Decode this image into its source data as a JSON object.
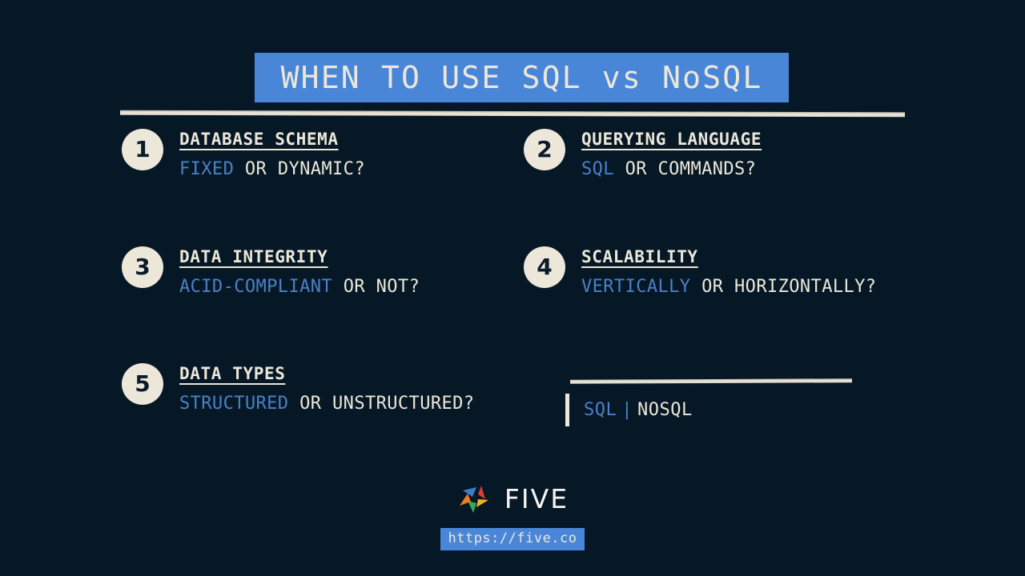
{
  "slide": {
    "title": "WHEN TO USE SQL vs NoSQL",
    "background_color": "#061826",
    "accent_blue": "#4a81c8",
    "highlight_blue": "#4a86d8",
    "cream": "#ece7d9"
  },
  "items": [
    {
      "number": "1",
      "title": "DATABASE SCHEMA",
      "sub_accent": "FIXED",
      "sub_rest": " OR DYNAMIC?"
    },
    {
      "number": "2",
      "title": "QUERYING LANGUAGE",
      "sub_accent": "SQL",
      "sub_rest": " OR COMMANDS?"
    },
    {
      "number": "3",
      "title": "DATA INTEGRITY",
      "sub_accent": "ACID-COMPLIANT",
      "sub_rest": " OR NOT?"
    },
    {
      "number": "4",
      "title": "SCALABILITY",
      "sub_accent": "VERTICALLY",
      "sub_rest": " OR HORIZONTALLY?"
    },
    {
      "number": "5",
      "title": "DATA TYPES",
      "sub_accent": "STRUCTURED",
      "sub_rest": " OR UNSTRUCTURED?"
    }
  ],
  "legend": {
    "left_label": "SQL",
    "separator": "|",
    "right_label": "NOSQL"
  },
  "footer": {
    "logo_text": "FIVE",
    "logo_icon": "five-pinwheel-logo",
    "url": "https://five.co",
    "logo_colors": {
      "blue": "#3b7fc4",
      "red": "#e03a35",
      "yellow": "#f0b323",
      "green": "#3aa757",
      "orange": "#ef7d1a"
    }
  }
}
